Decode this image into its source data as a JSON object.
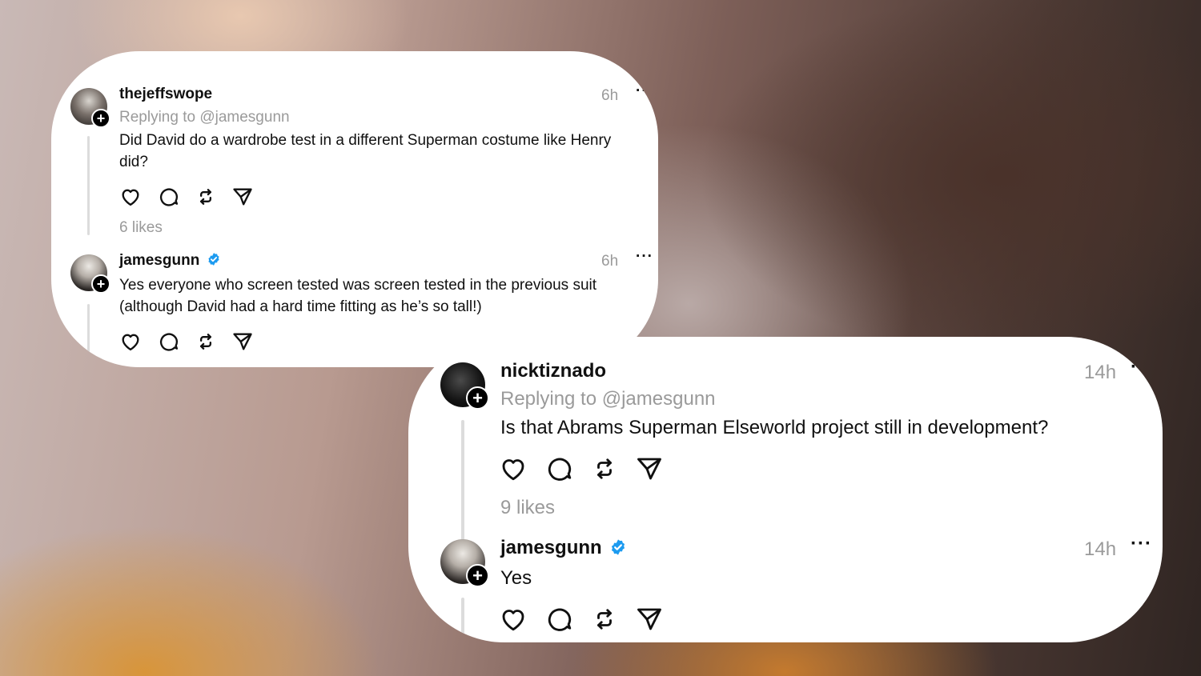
{
  "card1": {
    "post": {
      "username": "thejeffswope",
      "reply_to": "Replying to @jamesgunn",
      "time": "6h",
      "text_line1": "Did David do a wardrobe test in a different Superman costume like Henry",
      "text_line2": "did?",
      "likes": "6 likes"
    },
    "reply": {
      "username": "jamesgunn",
      "verified": true,
      "time": "6h",
      "text_line1": "Yes everyone who screen tested was screen tested in the previous suit",
      "text_line2": "(although David had a hard time fitting as he’s so tall!)"
    }
  },
  "card2": {
    "post": {
      "username": "nicktiznado",
      "reply_to": "Replying to @jamesgunn",
      "time": "14h",
      "text_line1": "Is that Abrams Superman Elseworld project still in development?",
      "likes": "9 likes"
    },
    "reply": {
      "username": "jamesgunn",
      "verified": true,
      "time": "14h",
      "text_line1": "Yes"
    }
  },
  "colors": {
    "verified_blue": "#1d9bf0",
    "muted_text": "#9a9a9a",
    "thread_line": "#dcdcdc"
  },
  "icons": [
    "heart-icon",
    "comment-icon",
    "repost-icon",
    "share-icon",
    "more-icon",
    "follow-plus-icon",
    "verified-badge-icon"
  ]
}
